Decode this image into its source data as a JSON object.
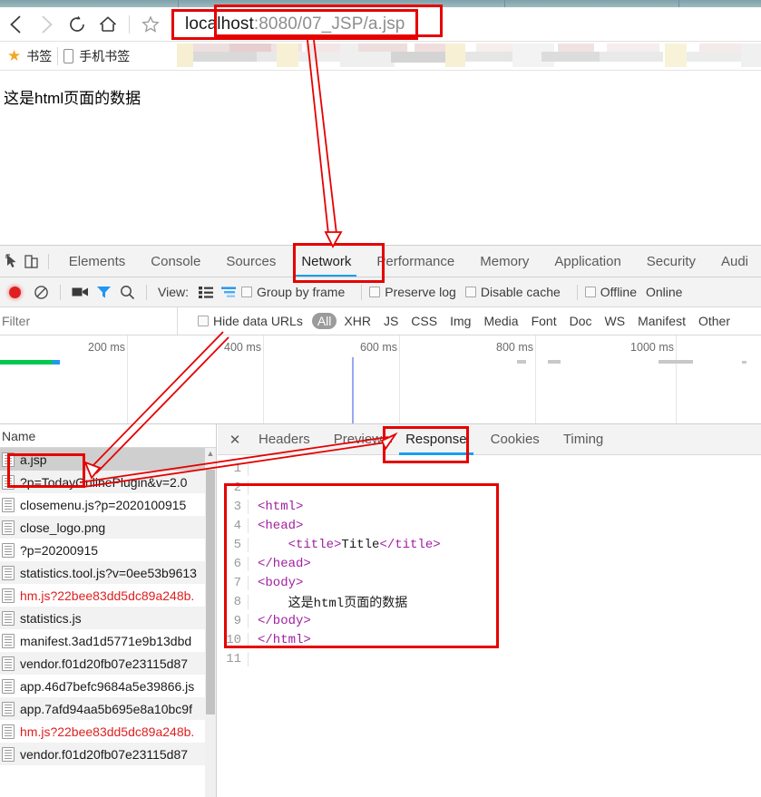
{
  "browser": {
    "nav": {
      "back": "back-arrow",
      "forward": "forward-arrow",
      "reload": "reload-icon",
      "home": "home-icon",
      "bookmark_star": "star-icon"
    },
    "address_bar": {
      "value": "localhost:8080/07_JSP/a.jsp",
      "host": "localhost",
      "rest": ":8080/07_JSP/a.jsp"
    },
    "bookmarks_bar": {
      "items": [
        {
          "label": "书签",
          "icon": "star-icon"
        },
        {
          "label": "手机书签",
          "icon": "mobile-phone-icon"
        }
      ]
    }
  },
  "page": {
    "body_text": "这是html页面的数据"
  },
  "devtools": {
    "panel_tabs": [
      {
        "label": "Elements",
        "active": false
      },
      {
        "label": "Console",
        "active": false
      },
      {
        "label": "Sources",
        "active": false
      },
      {
        "label": "Network",
        "active": true
      },
      {
        "label": "Performance",
        "active": false
      },
      {
        "label": "Memory",
        "active": false
      },
      {
        "label": "Application",
        "active": false
      },
      {
        "label": "Security",
        "active": false
      },
      {
        "label": "Audi",
        "active": false
      }
    ],
    "network_toolbar": {
      "record_title": "record-button",
      "clear_title": "clear-button",
      "camera_title": "screenshot-camera-icon",
      "filter_title": "filter-funnel-icon",
      "search_title": "search-icon",
      "view_label": "View:",
      "view_list_icon": "list-view-icon",
      "view_waterfall_icon": "waterfall-view-icon",
      "group_by_frame": "Group by frame",
      "preserve_log": "Preserve log",
      "disable_cache": "Disable cache",
      "offline": "Offline",
      "online": "Online"
    },
    "filter_bar": {
      "placeholder": "Filter",
      "value": "",
      "hide_data_urls": "Hide data URLs",
      "types": [
        {
          "label": "All",
          "active": true
        },
        {
          "label": "XHR",
          "active": false
        },
        {
          "label": "JS",
          "active": false
        },
        {
          "label": "CSS",
          "active": false
        },
        {
          "label": "Img",
          "active": false
        },
        {
          "label": "Media",
          "active": false
        },
        {
          "label": "Font",
          "active": false
        },
        {
          "label": "Doc",
          "active": false
        },
        {
          "label": "WS",
          "active": false
        },
        {
          "label": "Manifest",
          "active": false
        },
        {
          "label": "Other",
          "active": false
        }
      ]
    },
    "overview": {
      "ticks": [
        "200 ms",
        "400 ms",
        "600 ms",
        "800 ms",
        "1000 ms"
      ]
    },
    "requests": {
      "column_header": "Name",
      "rows": [
        {
          "name": "a.jsp",
          "selected": true,
          "error": false
        },
        {
          "name": "?p=TodayOnlinePlugin&v=2.0",
          "selected": false,
          "error": false
        },
        {
          "name": "closemenu.js?p=2020100915",
          "selected": false,
          "error": false
        },
        {
          "name": "close_logo.png",
          "selected": false,
          "error": false
        },
        {
          "name": "?p=20200915",
          "selected": false,
          "error": false
        },
        {
          "name": "statistics.tool.js?v=0ee53b9613",
          "selected": false,
          "error": false
        },
        {
          "name": "hm.js?22bee83dd5dc89a248b.",
          "selected": false,
          "error": true
        },
        {
          "name": "statistics.js",
          "selected": false,
          "error": false
        },
        {
          "name": "manifest.3ad1d5771e9b13dbd",
          "selected": false,
          "error": false
        },
        {
          "name": "vendor.f01d20fb07e23115d87",
          "selected": false,
          "error": false
        },
        {
          "name": "app.46d7befc9684a5e39866.js",
          "selected": false,
          "error": false
        },
        {
          "name": "app.7afd94aa5b695e8a10bc9f",
          "selected": false,
          "error": false
        },
        {
          "name": "hm.js?22bee83dd5dc89a248b.",
          "selected": false,
          "error": true
        },
        {
          "name": "vendor.f01d20fb07e23115d87",
          "selected": false,
          "error": false
        }
      ]
    },
    "detail": {
      "close_icon": "close-icon",
      "tabs": [
        {
          "label": "Headers",
          "active": false
        },
        {
          "label": "Preview",
          "active": false
        },
        {
          "label": "Response",
          "active": true
        },
        {
          "label": "Cookies",
          "active": false
        },
        {
          "label": "Timing",
          "active": false
        }
      ],
      "response_lines": [
        {
          "n": "1",
          "parts": []
        },
        {
          "n": "2",
          "parts": []
        },
        {
          "n": "3",
          "parts": [
            {
              "t": "tag",
              "s": "<html>"
            }
          ]
        },
        {
          "n": "4",
          "parts": [
            {
              "t": "tag",
              "s": "<head>"
            }
          ]
        },
        {
          "n": "5",
          "parts": [
            {
              "t": "tag",
              "s": "    <title>"
            },
            {
              "t": "txt",
              "s": "Title"
            },
            {
              "t": "tag",
              "s": "</title>"
            }
          ]
        },
        {
          "n": "6",
          "parts": [
            {
              "t": "tag",
              "s": "</head>"
            }
          ]
        },
        {
          "n": "7",
          "parts": [
            {
              "t": "tag",
              "s": "<body>"
            }
          ]
        },
        {
          "n": "8",
          "parts": [
            {
              "t": "txt",
              "s": "    这是html页面的数据"
            }
          ]
        },
        {
          "n": "9",
          "parts": [
            {
              "t": "tag",
              "s": "</body>"
            }
          ]
        },
        {
          "n": "10",
          "parts": [
            {
              "t": "tag",
              "s": "</html>"
            }
          ]
        },
        {
          "n": "11",
          "parts": []
        }
      ]
    }
  },
  "annotations": {
    "color": "#e60000",
    "boxes": [
      {
        "name": "url-highlight-box"
      },
      {
        "name": "network-tab-highlight-box"
      },
      {
        "name": "ajsp-row-highlight-box"
      },
      {
        "name": "response-tab-highlight-box"
      },
      {
        "name": "response-body-highlight-box"
      }
    ],
    "arrows": [
      {
        "name": "url-to-network-arrow"
      },
      {
        "name": "timeline-to-ajsp-arrow"
      },
      {
        "name": "ajsp-to-response-arrow"
      }
    ]
  }
}
